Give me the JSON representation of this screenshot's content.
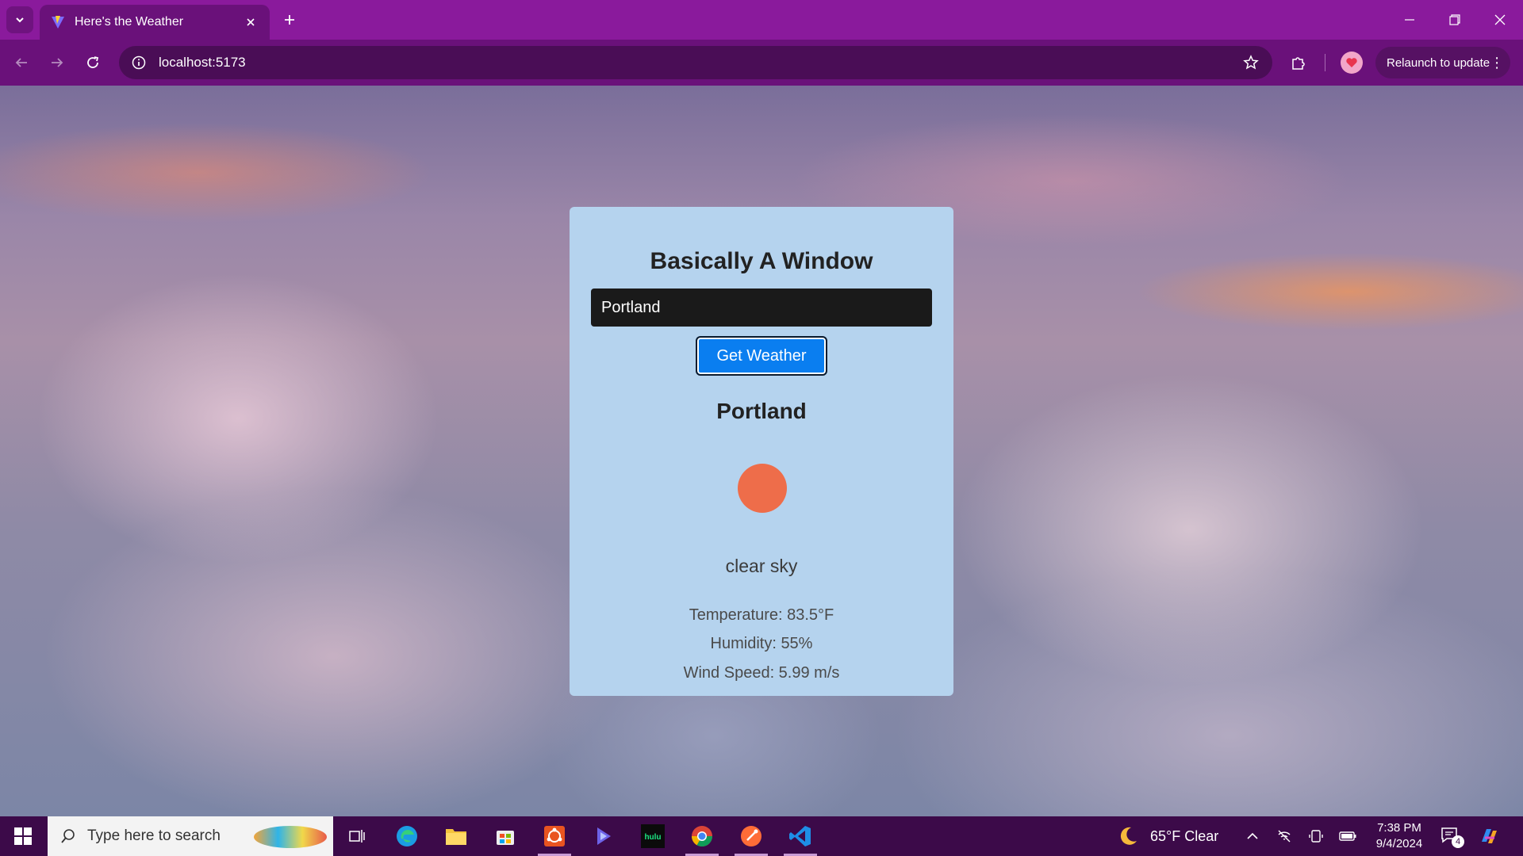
{
  "browser": {
    "tab_title": "Here's the Weather",
    "url": "localhost:5173",
    "relaunch_label": "Relaunch to update"
  },
  "app": {
    "title": "Basically A Window",
    "input_value": "Portland",
    "button_label": "Get Weather",
    "result_city": "Portland",
    "description": "clear sky",
    "temperature": "Temperature: 83.5°F",
    "humidity": "Humidity: 55%",
    "wind_speed": "Wind Speed: 5.99 m/s",
    "icon_color": "#ee6d4a",
    "card_color": "#b5d3ee",
    "button_color": "#0a7ef0"
  },
  "taskbar": {
    "search_placeholder": "Type here to search",
    "weather": "65°F  Clear",
    "time": "7:38 PM",
    "date": "9/4/2024",
    "notification_count": "4",
    "apps": [
      "task-view",
      "edge",
      "file-explorer",
      "microsoft-store",
      "ubuntu",
      "copilot",
      "hulu",
      "chrome",
      "postman",
      "vs-code"
    ]
  }
}
